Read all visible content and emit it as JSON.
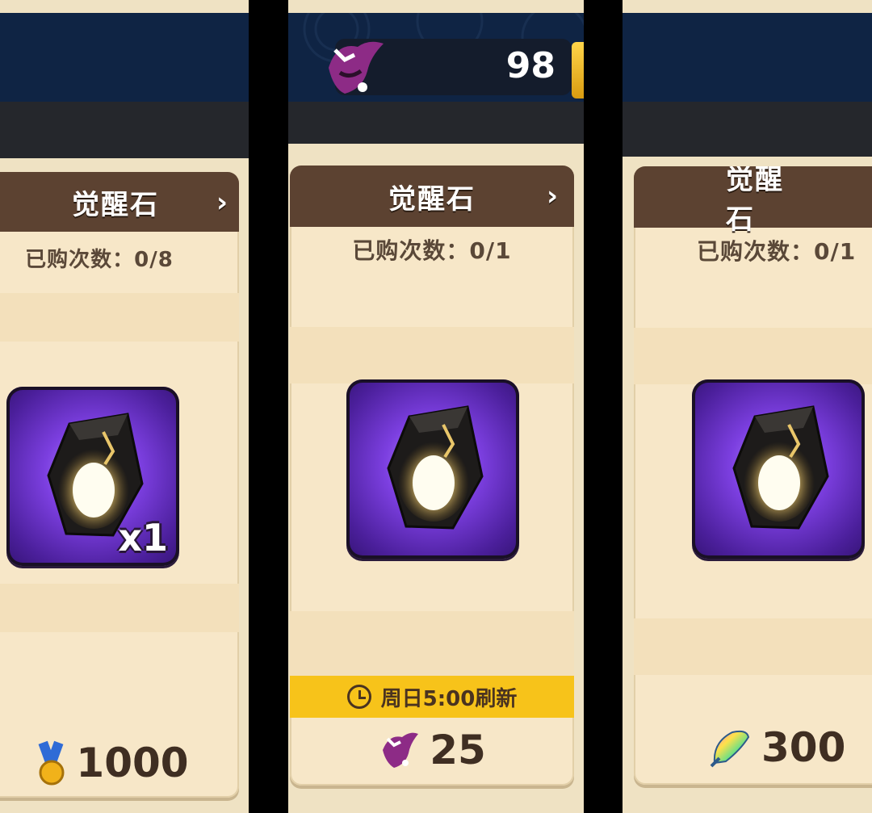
{
  "panels": [
    {
      "card": {
        "title": "觉醒石",
        "chevron": "›",
        "purchase_count": "已购次数：0/8",
        "item": {
          "icon": "awakening-stone-icon",
          "quantity": "x1"
        },
        "price": {
          "icon": "medal-icon",
          "value": "1000"
        }
      }
    },
    {
      "currency": {
        "icon": "purple-bat-emblem-icon",
        "value": "98"
      },
      "card": {
        "title": "觉醒石",
        "chevron": "›",
        "purchase_count": "已购次数：0/1",
        "item": {
          "icon": "awakening-stone-icon"
        },
        "refresh": {
          "icon": "clock-icon",
          "text": "周日5:00刷新"
        },
        "price": {
          "icon": "purple-bat-emblem-icon",
          "value": "25"
        }
      }
    },
    {
      "card": {
        "title": "觉醒石",
        "purchase_count": "已购次数：0/1",
        "item": {
          "icon": "awakening-stone-icon"
        },
        "price": {
          "icon": "rainbow-fish-icon",
          "value": "300"
        }
      }
    }
  ],
  "colors": {
    "header_brown": "#5c4231",
    "card_bg": "#f7e7c8",
    "tile_purple": "#7c3fe0",
    "refresh_yellow": "#f7c31a",
    "top_navy": "#0f2444"
  }
}
